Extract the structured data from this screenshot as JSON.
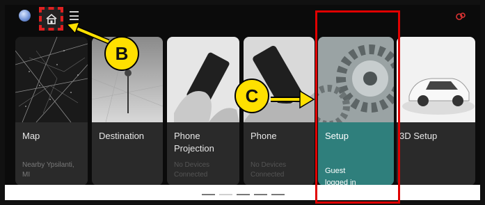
{
  "status_bar": {
    "globe_icon": "globe-icon",
    "home_icon": "home-icon",
    "menu_icon": "hamburger-menu-icon",
    "status_icon": "connection-status-icon"
  },
  "cards": [
    {
      "title": "Map",
      "subtitle": "Nearby Ypsilanti,\nMI",
      "icon": "map-image"
    },
    {
      "title": "Destination",
      "subtitle": "",
      "icon": "destination-image"
    },
    {
      "title": "Phone\nProjection",
      "subtitle": "No Devices\nConnected",
      "icon": "phone-projection-image"
    },
    {
      "title": "Phone",
      "subtitle": "No Devices\nConnected",
      "icon": "phone-image"
    },
    {
      "title": "Setup",
      "subtitle": "Guest\nlogged in",
      "icon": "gears-image"
    },
    {
      "title": "3D Setup",
      "subtitle": "",
      "icon": "car-image"
    }
  ],
  "callouts": {
    "b": "B",
    "c": "C"
  },
  "pager": {
    "pages": 5,
    "active_index": 1
  },
  "colors": {
    "highlight_red": "#e00000",
    "callout_yellow": "#ffe000",
    "setup_teal": "#2f7f7c"
  }
}
